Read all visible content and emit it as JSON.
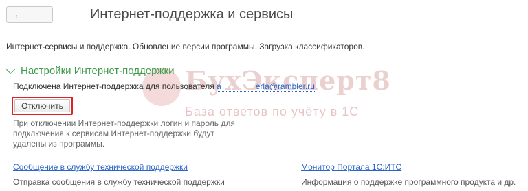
{
  "nav": {
    "back_icon": "arrow-left-icon",
    "forward_icon": "arrow-right-icon"
  },
  "page": {
    "title": "Интернет-поддержка и сервисы",
    "subtitle": "Интернет-сервисы и поддержка. Обновление версии программы. Загрузка классификаторов."
  },
  "support_section": {
    "title": "Настройки Интернет-поддержки",
    "connected_label": "Подключена Интернет-поддержка для пользователя",
    "user_email": "a               erla@rambler.ru",
    "disconnect_label": "Отключить",
    "disconnect_note": "При отключении Интернет-поддержки логин и пароль для подключения к сервисам Интернет-поддержки будут удалены из программы."
  },
  "links": [
    {
      "label": "Сообщение в службу технической поддержки",
      "description": "Отправка сообщения в службу технической поддержки"
    },
    {
      "label": "Монитор Портала 1С:ИТС",
      "description": "Информация о поддержке программного продукта и др."
    }
  ],
  "watermark": {
    "title": "БухЭксперт8",
    "subtitle": "База ответов по учёту в 1С"
  },
  "colors": {
    "accent_green": "#3f9b4c",
    "link_blue": "#2a64c8",
    "highlight_red": "#e11f25"
  }
}
